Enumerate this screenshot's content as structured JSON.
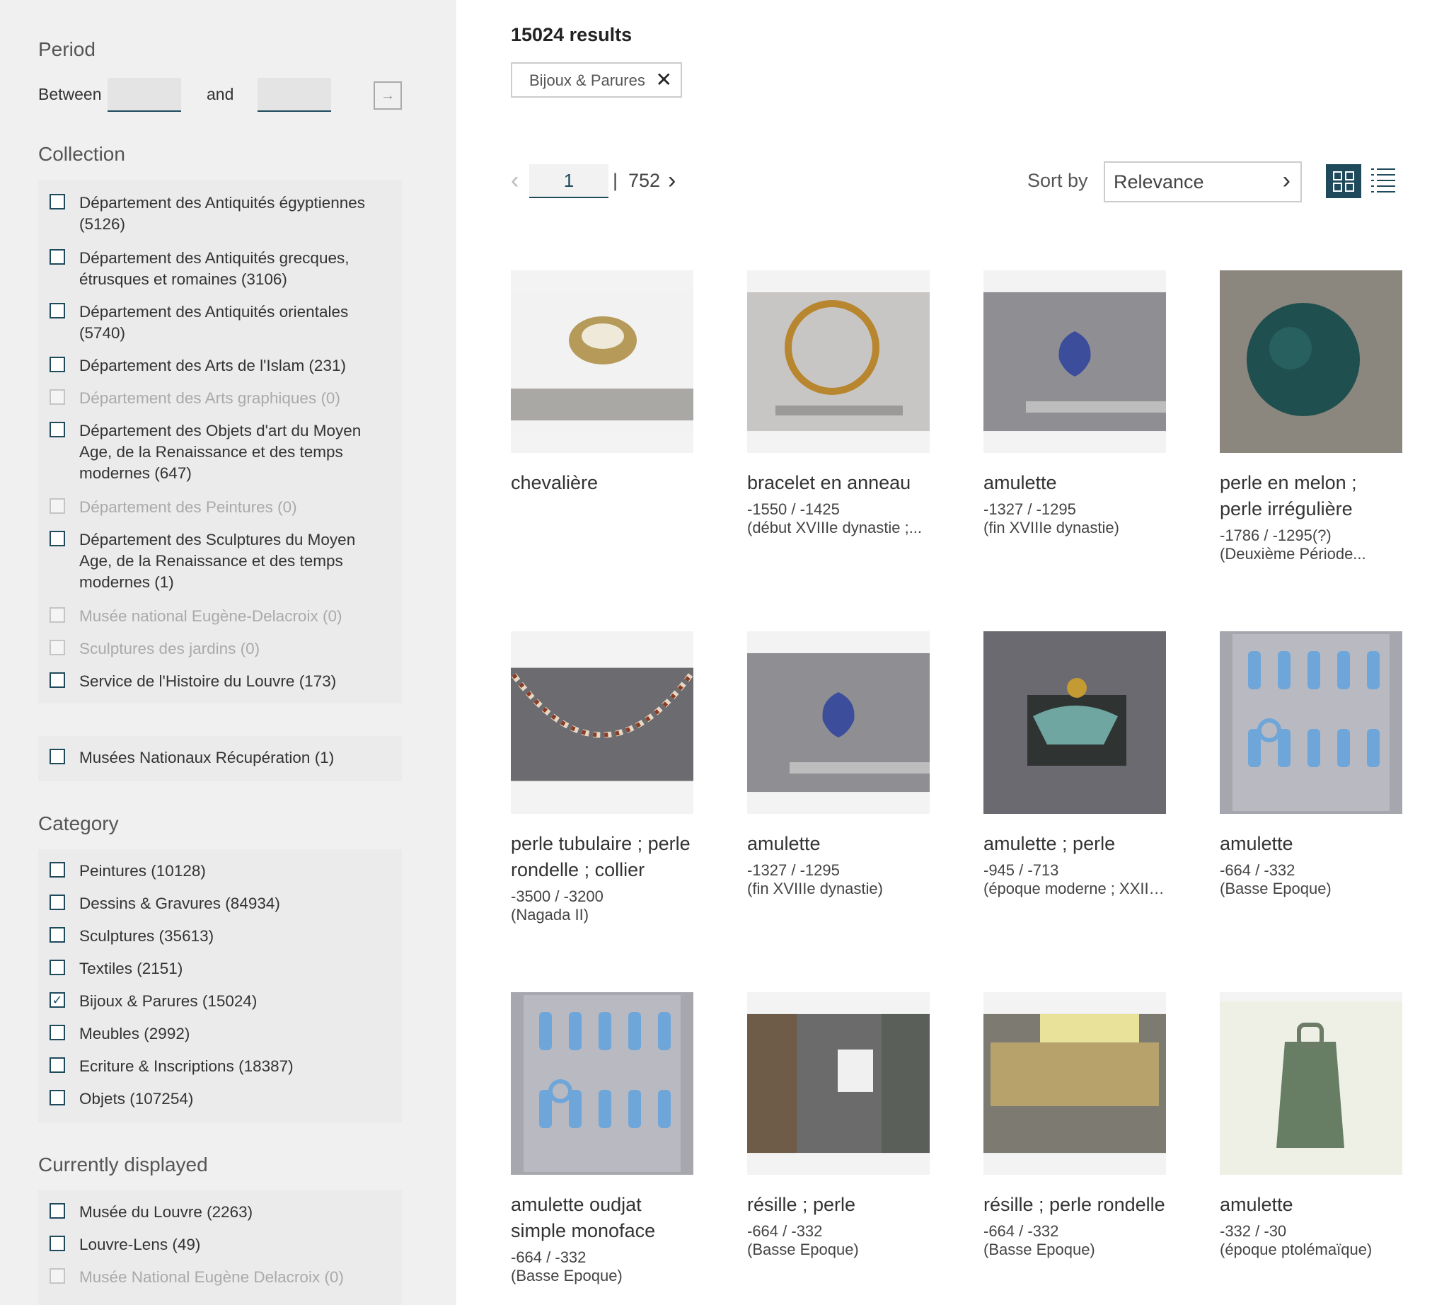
{
  "filters": {
    "period": {
      "title": "Period",
      "between_label": "Between",
      "and_label": "and",
      "go_icon": "arrow-right-icon"
    },
    "collection": {
      "title": "Collection",
      "items": [
        {
          "label": "Département des Antiquités égyptiennes (5126)",
          "checked": false,
          "disabled": false
        },
        {
          "label": "Département des Antiquités grecques, étrusques et romaines (3106)",
          "checked": false,
          "disabled": false
        },
        {
          "label": "Département des Antiquités orientales (5740)",
          "checked": false,
          "disabled": false
        },
        {
          "label": "Département des Arts de l'Islam (231)",
          "checked": false,
          "disabled": false
        },
        {
          "label": "Département des Arts graphiques (0)",
          "checked": false,
          "disabled": true
        },
        {
          "label": "Département des Objets d'art du Moyen Age, de la Renaissance et des temps modernes (647)",
          "checked": false,
          "disabled": false
        },
        {
          "label": "Département des Peintures (0)",
          "checked": false,
          "disabled": true
        },
        {
          "label": "Département des Sculptures du Moyen Age, de la Renaissance et des temps modernes (1)",
          "checked": false,
          "disabled": false
        },
        {
          "label": "Musée national Eugène-Delacroix (0)",
          "checked": false,
          "disabled": true
        },
        {
          "label": "Sculptures des jardins (0)",
          "checked": false,
          "disabled": true
        },
        {
          "label": "Service de l'Histoire du Louvre (173)",
          "checked": false,
          "disabled": false
        }
      ],
      "extra": {
        "label": "Musées Nationaux Récupération (1)",
        "checked": false,
        "disabled": false
      }
    },
    "category": {
      "title": "Category",
      "items": [
        {
          "label": "Peintures (10128)",
          "checked": false
        },
        {
          "label": "Dessins & Gravures (84934)",
          "checked": false
        },
        {
          "label": "Sculptures (35613)",
          "checked": false
        },
        {
          "label": "Textiles (2151)",
          "checked": false
        },
        {
          "label": "Bijoux & Parures (15024)",
          "checked": true
        },
        {
          "label": "Meubles (2992)",
          "checked": false
        },
        {
          "label": "Ecriture & Inscriptions (18387)",
          "checked": false
        },
        {
          "label": "Objets (107254)",
          "checked": false
        }
      ]
    },
    "displayed": {
      "title": "Currently displayed",
      "items": [
        {
          "label": "Musée du Louvre (2263)",
          "checked": false,
          "disabled": false
        },
        {
          "label": "Louvre-Lens (49)",
          "checked": false,
          "disabled": false
        },
        {
          "label": "Musée National Eugène Delacroix (0)",
          "checked": false,
          "disabled": true
        }
      ]
    }
  },
  "results": {
    "count_label": "15024 results",
    "active_chip": "Bijoux & Parures",
    "chip_close_icon": "close-icon"
  },
  "pagination": {
    "current": "1",
    "separator": "|",
    "total": "752",
    "prev_icon": "chevron-left-icon",
    "next_icon": "chevron-right-icon"
  },
  "sort": {
    "label": "Sort by",
    "value": "Relevance",
    "chevron_icon": "chevron-right-icon"
  },
  "view": {
    "grid_icon": "grid-view-icon",
    "list_icon": "list-view-icon"
  },
  "cards": [
    {
      "title": "chevalière",
      "date": "",
      "period": ""
    },
    {
      "title": "bracelet en anneau",
      "date": "-1550 / -1425",
      "period": "(début XVIIIe dynastie ;..."
    },
    {
      "title": "amulette",
      "date": "-1327 / -1295",
      "period": "(fin XVIIIe dynastie)"
    },
    {
      "title": "perle en melon ; perle irrégulière",
      "date": "-1786 / -1295(?)",
      "period": "(Deuxième Période..."
    },
    {
      "title": "perle tubulaire ; perle rondelle ; collier",
      "date": "-3500 / -3200",
      "period": "(Nagada II)"
    },
    {
      "title": "amulette",
      "date": "-1327 / -1295",
      "period": "(fin XVIIIe dynastie)"
    },
    {
      "title": "amulette ; perle",
      "date": "-945 / -713",
      "period": "(époque moderne ; XXIIe..."
    },
    {
      "title": "amulette",
      "date": "-664 / -332",
      "period": "(Basse Epoque)"
    },
    {
      "title": "amulette oudjat simple monoface",
      "date": "-664 / -332",
      "period": "(Basse Epoque)"
    },
    {
      "title": "résille ; perle",
      "date": "-664 / -332",
      "period": "(Basse Epoque)"
    },
    {
      "title": "résille ; perle rondelle",
      "date": "-664 / -332",
      "period": "(Basse Epoque)"
    },
    {
      "title": "amulette",
      "date": "-332 / -30",
      "period": "(époque ptolémaïque)"
    }
  ]
}
